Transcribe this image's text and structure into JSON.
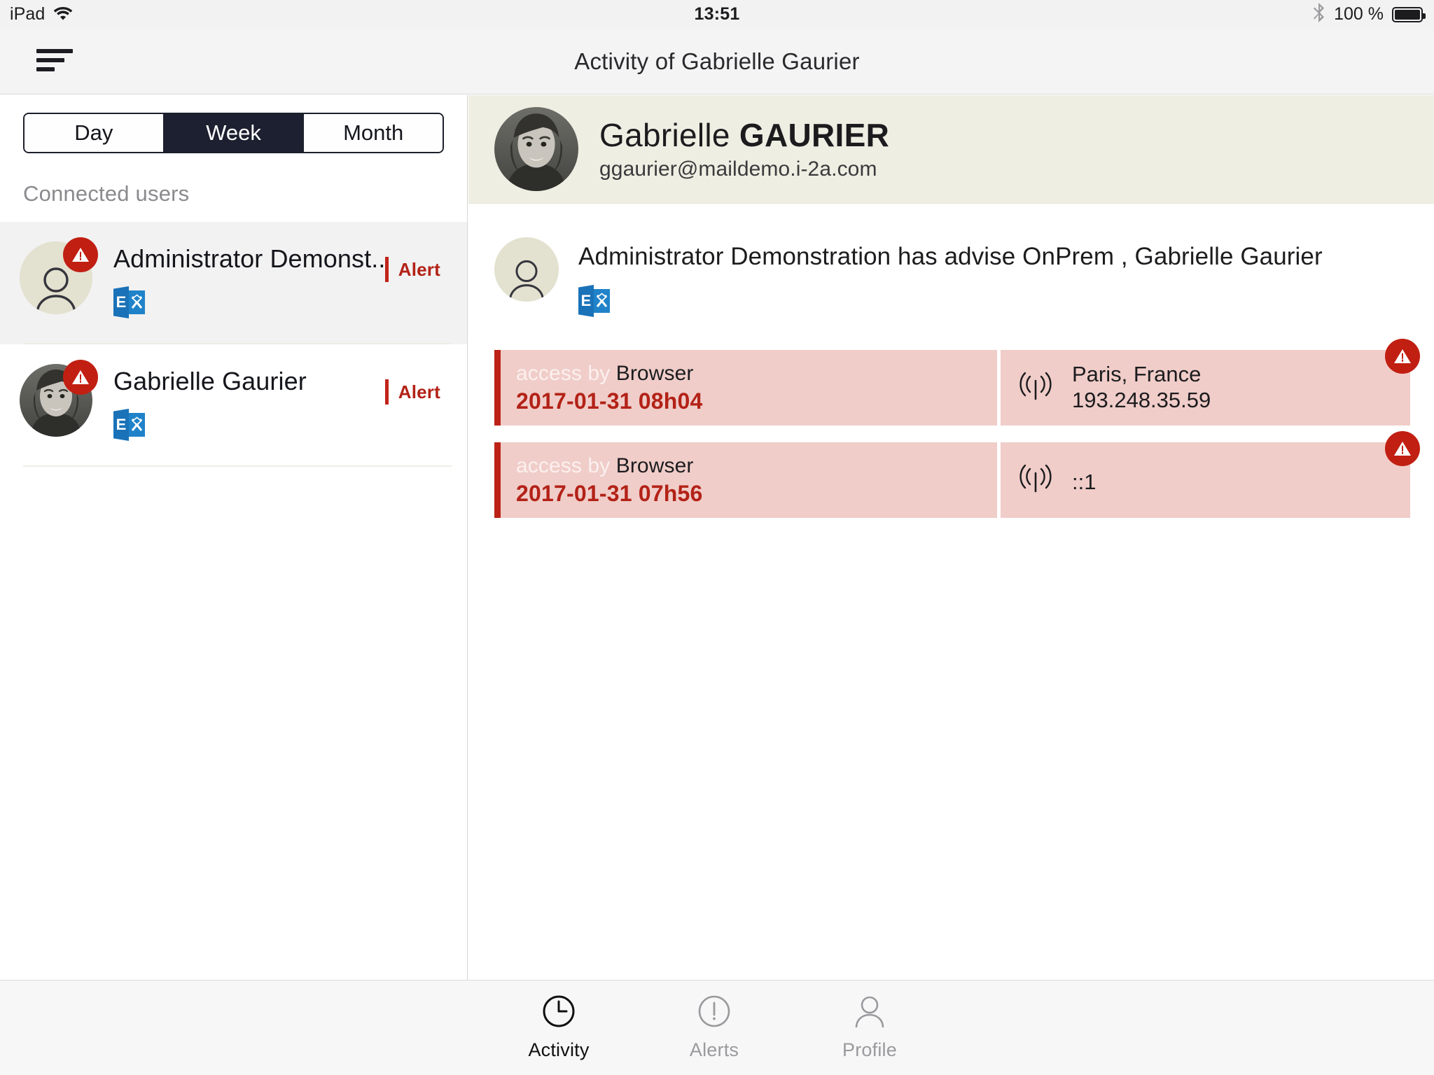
{
  "status_bar": {
    "device": "iPad",
    "wifi_icon": "wifi-icon",
    "time": "13:51",
    "bluetooth_icon": "bluetooth-icon",
    "battery_percent": "100 %",
    "battery_icon": "battery-full-icon"
  },
  "nav": {
    "menu_icon": "hamburger-menu-icon",
    "title": "Activity of Gabrielle Gaurier"
  },
  "sidebar": {
    "period_segments": [
      {
        "label": "Day",
        "active": false
      },
      {
        "label": "Week",
        "active": true
      },
      {
        "label": "Month",
        "active": false
      }
    ],
    "section_label": "Connected users",
    "users": [
      {
        "name": "Administrator Demonst...",
        "alert_label": "Alert",
        "selected": true,
        "avatar": "default-person-avatar",
        "service_icon": "microsoft-exchange-icon",
        "badge_icon": "alert-triangle-icon"
      },
      {
        "name": "Gabrielle Gaurier",
        "alert_label": "Alert",
        "selected": false,
        "avatar": "photo-avatar",
        "service_icon": "microsoft-exchange-icon",
        "badge_icon": "alert-triangle-icon"
      }
    ]
  },
  "profile_header": {
    "avatar": "photo-avatar",
    "first_name": "Gabrielle",
    "last_name": "GAURIER",
    "email": "ggaurier@maildemo.i-2a.com"
  },
  "activity": {
    "avatar": "default-person-avatar",
    "message": "Administrator Demonstration has advise OnPrem , Gabrielle Gaurier",
    "service_icon": "microsoft-exchange-icon",
    "entries": [
      {
        "access_prefix": "access by",
        "access_method": "Browser",
        "timestamp": "2017-01-31 08h04",
        "location_icon": "broadcast-signal-icon",
        "location": "Paris, France",
        "ip": "193.248.35.59",
        "badge_icon": "alert-triangle-icon"
      },
      {
        "access_prefix": "access by",
        "access_method": "Browser",
        "timestamp": "2017-01-31 07h56",
        "location_icon": "broadcast-signal-icon",
        "location": "",
        "ip": "::1",
        "badge_icon": "alert-triangle-icon"
      }
    ]
  },
  "tabbar": {
    "tabs": [
      {
        "label": "Activity",
        "icon": "clock-icon",
        "active": true
      },
      {
        "label": "Alerts",
        "icon": "exclamation-circle-icon",
        "active": false
      },
      {
        "label": "Profile",
        "icon": "person-icon",
        "active": false
      }
    ]
  },
  "colors": {
    "accent_dark": "#1c2030",
    "alert_red": "#c11f12",
    "alert_text_red": "#b32217",
    "card_pink": "#f0cdc9",
    "header_beige": "#efeee3",
    "exchange_blue": "#1a72b8"
  }
}
